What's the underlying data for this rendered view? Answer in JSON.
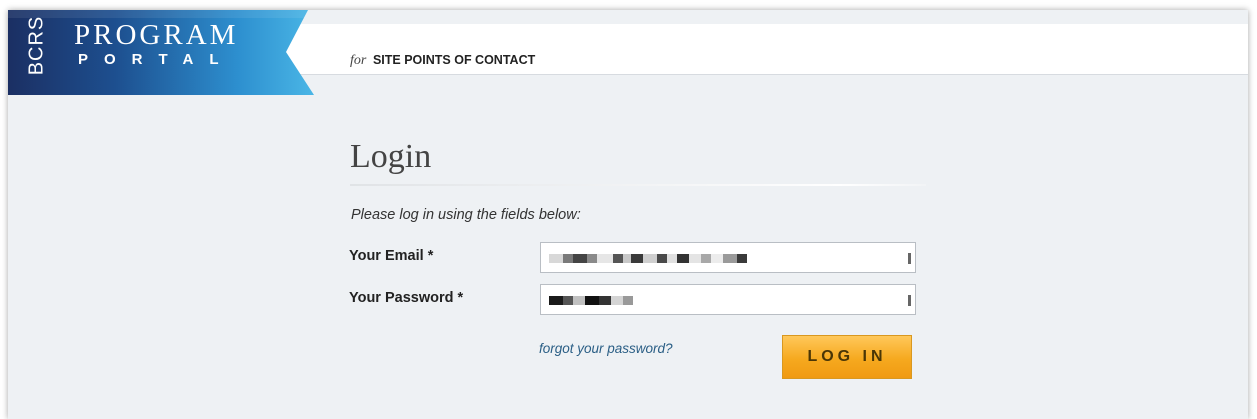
{
  "header": {
    "logo": {
      "vertical_text": "BCRS",
      "line1": "PROGRAM",
      "line2": "PORTAL"
    },
    "tagline_prefix": "for",
    "tagline_text": "SITE POINTS OF CONTACT"
  },
  "login": {
    "title": "Login",
    "instructions": "Please log in using the fields below:",
    "email_label": "Your Email *",
    "password_label": "Your Password *",
    "forgot_link": "forgot your password?",
    "login_button": "LOG IN"
  },
  "colors": {
    "banner_dark": "#1b2f63",
    "banner_light": "#34a8e0",
    "button_orange": "#f6a91f",
    "link_blue": "#2a5e85",
    "page_background": "#eef1f4"
  }
}
